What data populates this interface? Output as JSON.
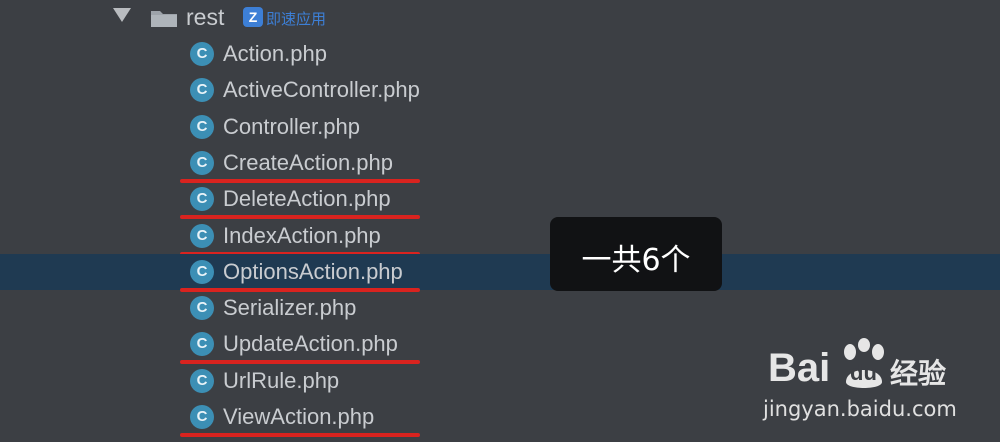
{
  "folder": {
    "name": "rest",
    "badge_letter": "Z",
    "badge_text": "即速应用"
  },
  "class_icon_letter": "C",
  "files": [
    {
      "name": "Action.php",
      "underlined": false,
      "selected": false
    },
    {
      "name": "ActiveController.php",
      "underlined": false,
      "selected": false
    },
    {
      "name": "Controller.php",
      "underlined": false,
      "selected": false
    },
    {
      "name": "CreateAction.php",
      "underlined": true,
      "selected": false
    },
    {
      "name": "DeleteAction.php",
      "underlined": true,
      "selected": false
    },
    {
      "name": "IndexAction.php",
      "underlined": true,
      "selected": false
    },
    {
      "name": "OptionsAction.php",
      "underlined": true,
      "selected": true
    },
    {
      "name": "Serializer.php",
      "underlined": false,
      "selected": false
    },
    {
      "name": "UpdateAction.php",
      "underlined": true,
      "selected": false
    },
    {
      "name": "UrlRule.php",
      "underlined": false,
      "selected": false
    },
    {
      "name": "ViewAction.php",
      "underlined": true,
      "selected": false
    }
  ],
  "annotation": {
    "text": "一共6个"
  },
  "watermark": {
    "brand_left": "Bai",
    "brand_paw": "du",
    "brand_right": "经验",
    "url": "jingyan.baidu.com"
  },
  "colors": {
    "background": "#3c3f44",
    "selection": "#1f3a52",
    "underline": "#d9231f",
    "class_icon": "#3c8fb5"
  }
}
